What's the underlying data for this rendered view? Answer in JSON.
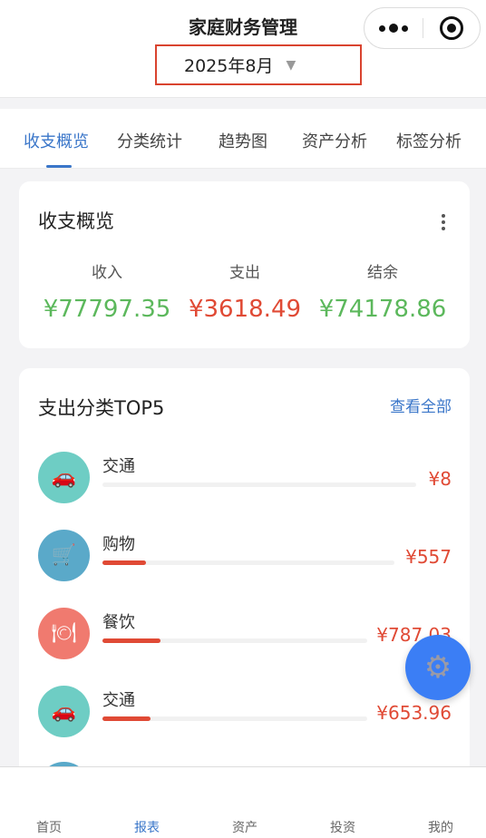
{
  "header": {
    "title": "家庭财务管理",
    "month": "2025年8月",
    "caret": "▼"
  },
  "tabs": [
    {
      "label": "收支概览",
      "active": true
    },
    {
      "label": "分类统计",
      "active": false
    },
    {
      "label": "趋势图",
      "active": false
    },
    {
      "label": "资产分析",
      "active": false
    },
    {
      "label": "标签分析",
      "active": false
    }
  ],
  "overview": {
    "title": "收支概览",
    "income": {
      "label": "收入",
      "value": "¥77797.35"
    },
    "expense": {
      "label": "支出",
      "value": "¥3618.49"
    },
    "balance": {
      "label": "结余",
      "value": "¥74178.86"
    }
  },
  "top5": {
    "title": "支出分类TOP5",
    "view_all": "查看全部",
    "items": [
      {
        "name": "交通",
        "amount": "¥8",
        "progress": 0.0,
        "icon": "car-icon",
        "color": "#6ecdc4"
      },
      {
        "name": "购物",
        "amount": "¥557",
        "progress": 0.15,
        "icon": "cart-icon",
        "color": "#5aa9c9"
      },
      {
        "name": "餐饮",
        "amount": "¥787.03",
        "progress": 0.22,
        "icon": "plate-icon",
        "color": "#f07a6f"
      },
      {
        "name": "交通",
        "amount": "¥653.96",
        "progress": 0.18,
        "icon": "car-icon",
        "color": "#6ecdc4"
      }
    ]
  },
  "nav": [
    {
      "label": "首页",
      "active": false
    },
    {
      "label": "报表",
      "active": true
    },
    {
      "label": "资产",
      "active": false
    },
    {
      "label": "投资",
      "active": false
    },
    {
      "label": "我的",
      "active": false
    }
  ]
}
